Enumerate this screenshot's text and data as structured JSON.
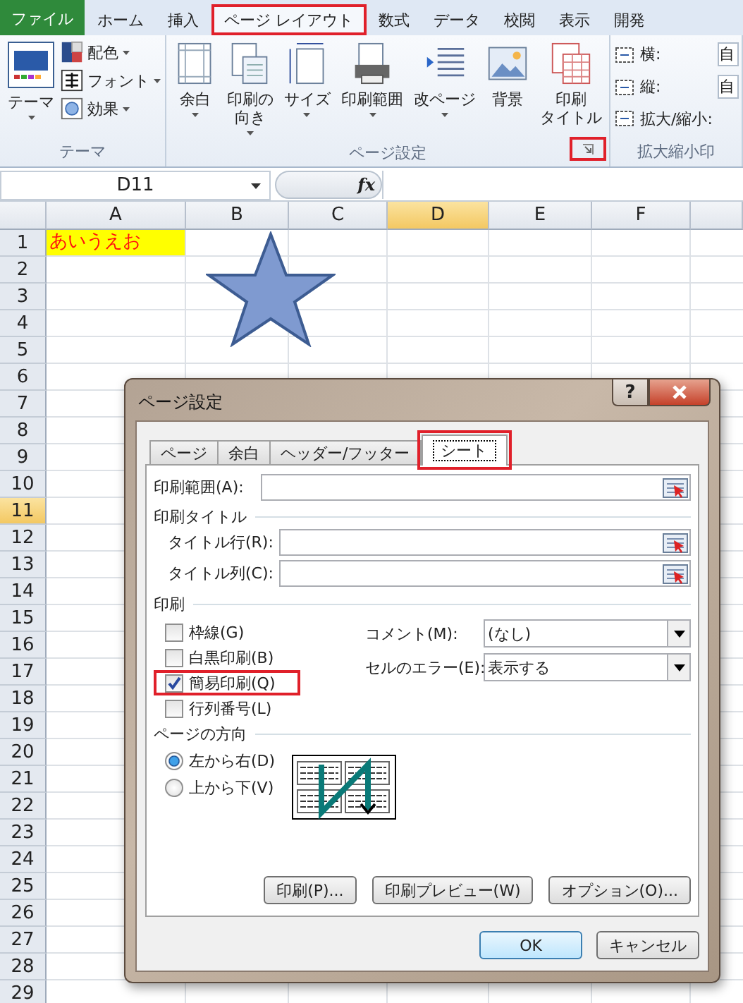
{
  "ribbon_tabs": [
    {
      "label": "ファイル",
      "kind": "file",
      "selected": false,
      "highlighted": false
    },
    {
      "label": "ホーム",
      "kind": "tab",
      "selected": false,
      "highlighted": false
    },
    {
      "label": "挿入",
      "kind": "tab",
      "selected": false,
      "highlighted": false
    },
    {
      "label": "ページ レイアウト",
      "kind": "tab",
      "selected": true,
      "highlighted": true
    },
    {
      "label": "数式",
      "kind": "tab",
      "selected": false,
      "highlighted": false
    },
    {
      "label": "データ",
      "kind": "tab",
      "selected": false,
      "highlighted": false
    },
    {
      "label": "校閲",
      "kind": "tab",
      "selected": false,
      "highlighted": false
    },
    {
      "label": "表示",
      "kind": "tab",
      "selected": false,
      "highlighted": false
    },
    {
      "label": "開発",
      "kind": "tab",
      "selected": false,
      "highlighted": false
    }
  ],
  "theme_group": {
    "label": "テーマ",
    "themes_button": {
      "label": "テーマ"
    },
    "options": [
      {
        "label": "配色"
      },
      {
        "label": "フォント"
      },
      {
        "label": "効果"
      }
    ]
  },
  "page_setup_group": {
    "label": "ページ設定",
    "launcher_highlighted": true,
    "buttons": [
      {
        "lines": [
          "余白"
        ],
        "dropdown": true
      },
      {
        "lines": [
          "印刷の",
          "向き"
        ],
        "dropdown": true
      },
      {
        "lines": [
          "サイズ"
        ],
        "dropdown": true
      },
      {
        "lines": [
          "印刷範囲"
        ],
        "dropdown": true
      },
      {
        "lines": [
          "改ページ"
        ],
        "dropdown": true
      },
      {
        "lines": [
          "背景"
        ],
        "dropdown": false
      },
      {
        "lines": [
          "印刷",
          "タイトル"
        ],
        "dropdown": false
      }
    ]
  },
  "scale_group": {
    "label": "拡大縮小印",
    "rows": [
      {
        "label": "横:",
        "value": "自"
      },
      {
        "label": "縦:",
        "value": "自"
      },
      {
        "label": "拡大/縮小:"
      }
    ]
  },
  "formula_bar": {
    "name_box": "D11",
    "function_label": "fx"
  },
  "sheet": {
    "columns": [
      {
        "label": "A",
        "selected": false
      },
      {
        "label": "B",
        "selected": false
      },
      {
        "label": "C",
        "selected": false
      },
      {
        "label": "D",
        "selected": true
      },
      {
        "label": "E",
        "selected": false
      },
      {
        "label": "F",
        "selected": false
      }
    ],
    "rows": [
      {
        "label": "1",
        "selected": false
      },
      {
        "label": "2",
        "selected": false
      },
      {
        "label": "3",
        "selected": false
      },
      {
        "label": "4",
        "selected": false
      },
      {
        "label": "5",
        "selected": false
      },
      {
        "label": "6",
        "selected": false
      },
      {
        "label": "7",
        "selected": false
      },
      {
        "label": "8",
        "selected": false
      },
      {
        "label": "9",
        "selected": false
      },
      {
        "label": "10",
        "selected": false
      },
      {
        "label": "11",
        "selected": true
      },
      {
        "label": "12",
        "selected": false
      },
      {
        "label": "13",
        "selected": false
      },
      {
        "label": "14",
        "selected": false
      },
      {
        "label": "15",
        "selected": false
      },
      {
        "label": "16",
        "selected": false
      },
      {
        "label": "17",
        "selected": false
      },
      {
        "label": "18",
        "selected": false
      },
      {
        "label": "19",
        "selected": false
      },
      {
        "label": "20",
        "selected": false
      },
      {
        "label": "21",
        "selected": false
      },
      {
        "label": "22",
        "selected": false
      },
      {
        "label": "23",
        "selected": false
      },
      {
        "label": "24",
        "selected": false
      },
      {
        "label": "25",
        "selected": false
      },
      {
        "label": "26",
        "selected": false
      },
      {
        "label": "27",
        "selected": false
      },
      {
        "label": "28",
        "selected": false
      },
      {
        "label": "29",
        "selected": false
      }
    ],
    "cell_a1": "あいうえお"
  },
  "dialog": {
    "title": "ページ設定",
    "help": "?",
    "tabs": [
      {
        "label": "ページ",
        "selected": false,
        "highlighted": false
      },
      {
        "label": "余白",
        "selected": false,
        "highlighted": false
      },
      {
        "label": "ヘッダー/フッター",
        "selected": false,
        "highlighted": false
      },
      {
        "label": "シート",
        "selected": true,
        "highlighted": true
      }
    ],
    "print_area_label": "印刷範囲(A):",
    "print_titles_heading": "印刷タイトル",
    "title_fields": [
      {
        "label": "タイトル行(R):"
      },
      {
        "label": "タイトル列(C):"
      }
    ],
    "print_heading": "印刷",
    "print_options": [
      {
        "label": "枠線(G)",
        "checked": false,
        "highlighted": false
      },
      {
        "label": "白黒印刷(B)",
        "checked": false,
        "highlighted": false
      },
      {
        "label": "簡易印刷(Q)",
        "checked": true,
        "highlighted": true
      },
      {
        "label": "行列番号(L)",
        "checked": false,
        "highlighted": false
      }
    ],
    "dropdowns": [
      {
        "label": "コメント(M):",
        "value": "(なし)"
      },
      {
        "label": "セルのエラー(E):",
        "value": "表示する"
      }
    ],
    "order_heading": "ページの方向",
    "order_options": [
      {
        "label": "左から右(D)",
        "selected": true
      },
      {
        "label": "上から下(V)",
        "selected": false
      }
    ],
    "action_buttons": [
      "印刷(P)...",
      "印刷プレビュー(W)",
      "オプション(O)..."
    ],
    "ok": "OK",
    "cancel": "キャンセル"
  }
}
